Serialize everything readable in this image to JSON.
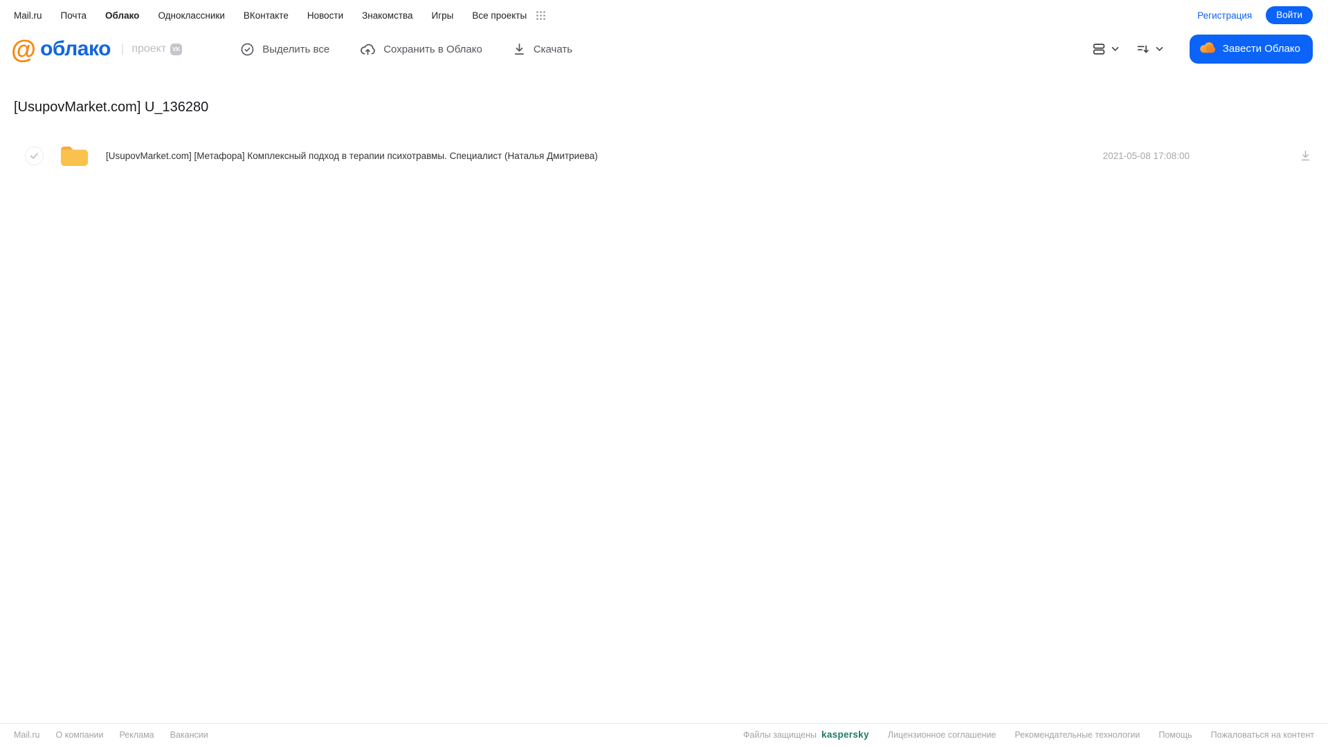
{
  "topbar": {
    "items": [
      "Mail.ru",
      "Почта",
      "Облако",
      "Одноклассники",
      "ВКонтакте",
      "Новости",
      "Знакомства",
      "Игры",
      "Все проекты"
    ],
    "registration_label": "Регистрация",
    "login_label": "Войти"
  },
  "header": {
    "logo_at": "@",
    "logo_name": "облако",
    "project_label": "проект",
    "vk_badge_label": "VK",
    "select_all_label": "Выделить все",
    "save_to_cloud_label": "Сохранить в Облако",
    "download_label": "Скачать",
    "create_cloud_label": "Завести Облако"
  },
  "page": {
    "title": "[UsupovMarket.com] U_136280"
  },
  "file_list": {
    "rows": [
      {
        "type": "folder",
        "name": "[UsupovMarket.com] [Метафора] Комплексный подход в терапии психотравмы. Специалист (Наталья Дмитриева)",
        "date": "2021-05-08 17:08:00"
      }
    ]
  },
  "footer": {
    "left_links": [
      "Mail.ru",
      "О компании",
      "Реклама",
      "Вакансии"
    ],
    "protected_label": "Файлы защищены",
    "kaspersky_label": "kaspersky",
    "right_links": [
      "Лицензионное соглашение",
      "Рекомендательные технологии",
      "Помощь",
      "Пожаловаться на контент"
    ]
  },
  "colors": {
    "accent_blue": "#0b63f8",
    "logo_blue": "#1266dd",
    "logo_orange": "#f7860d",
    "folder_yellow": "#fac14c",
    "kaspersky_teal": "#1e7a68",
    "footer_gray": "#a3a3a3"
  }
}
